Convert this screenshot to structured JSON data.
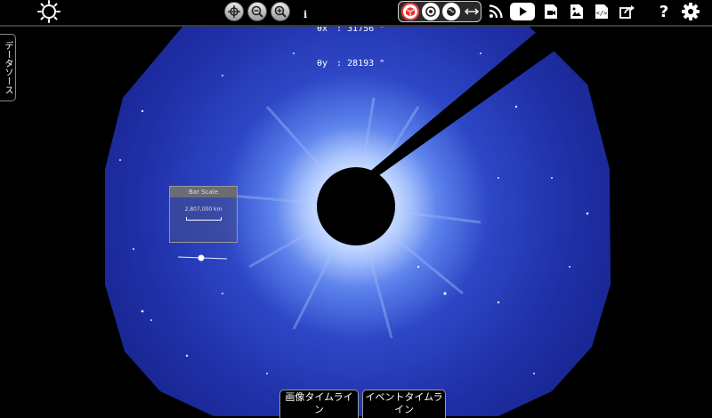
{
  "toolbar": {
    "info_label": "i",
    "coords": {
      "x_label": "θx",
      "x_value": "31756",
      "y_label": "θy",
      "y_value": "28193",
      "unit": "\""
    },
    "icons": [
      "helioviewer-logo-icon",
      "center-icon",
      "zoom-out-icon",
      "zoom-in-icon",
      "3d-view-icon",
      "2d-view-icon",
      "earth-view-icon",
      "swap-icon",
      "rss-icon",
      "youtube-icon",
      "movie-icon",
      "screenshot-icon",
      "data-download-icon",
      "share-icon",
      "help-icon",
      "settings-icon"
    ],
    "help_label": "?"
  },
  "data_sources_tab": {
    "label": "データソース"
  },
  "bar_scale": {
    "title": "Bar Scale",
    "value": "2,807,000 km"
  },
  "bottom_tabs": {
    "image_timeline": "画像タイムライン",
    "event_timeline": "イベントタイムライン"
  },
  "colors": {
    "corona_dark": "#1d2c9e",
    "corona_light": "#cfe0ff",
    "background": "#000000",
    "accent_red": "#e33333"
  }
}
